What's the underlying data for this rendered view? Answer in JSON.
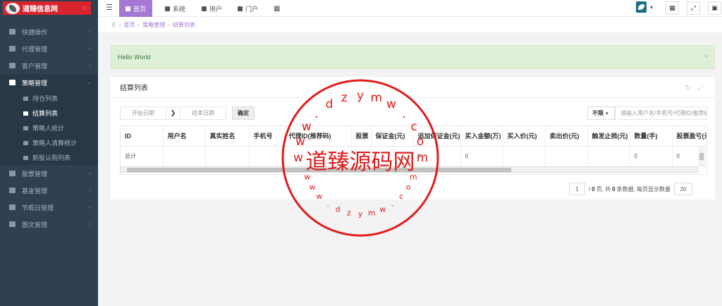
{
  "sidebar": {
    "logo_text": "道臻信息网",
    "items": [
      {
        "label": "快捷操作"
      },
      {
        "label": "代理管理"
      },
      {
        "label": "客户管理"
      },
      {
        "label": "策略管理"
      },
      {
        "label": "股票管理"
      },
      {
        "label": "基金管理"
      },
      {
        "label": "节假日管理"
      },
      {
        "label": "图文管理"
      }
    ],
    "sub_items": [
      {
        "label": "持仓列表"
      },
      {
        "label": "结算列表"
      },
      {
        "label": "策略人统计"
      },
      {
        "label": "策略人清算统计"
      },
      {
        "label": "新股认购列表"
      }
    ]
  },
  "topbar": {
    "tabs": [
      {
        "label": "首页"
      },
      {
        "label": "系统"
      },
      {
        "label": "用户"
      },
      {
        "label": "门户"
      }
    ]
  },
  "breadcrumb": {
    "home": "首页",
    "level1": "策略管理",
    "level2": "结算列表"
  },
  "alert": {
    "message": "Hello World",
    "close": "×"
  },
  "panel": {
    "title": "结算列表",
    "start_date_placeholder": "开始日期",
    "end_date_placeholder": "结束日期",
    "confirm_label": "确定",
    "filter_select": "不限",
    "search_placeholder": "请输入用户名/手机号/代理ID/推荐码"
  },
  "table": {
    "columns": [
      "ID",
      "用户名",
      "真实姓名",
      "手机号",
      "代理ID(推荐码)",
      "股票",
      "保证金(元)",
      "追加保证金(元)",
      "买入金额(万)",
      "买入价(元)",
      "卖出价(元)",
      "触发止损(元)",
      "数量(手)",
      "股票盈亏(元)"
    ],
    "total_row": [
      "总计",
      "",
      "",
      "",
      "",
      "",
      "",
      "0",
      "0",
      "",
      "",
      "",
      "0",
      "0"
    ]
  },
  "pager": {
    "page": "1",
    "total_pages": "0",
    "total_rows": "0",
    "page_size": "20",
    "text_a": "/",
    "text_b": "页, 共",
    "text_c": "条数据, 每页显示数量"
  },
  "stamp": {
    "center_text": "道臻源码网",
    "ring_text": "www.dzymw.com"
  },
  "colors": {
    "sidebar": "#2f4050",
    "accent": "#a678d6",
    "stamp": "#e01c1c",
    "logo": "#d9232d"
  }
}
